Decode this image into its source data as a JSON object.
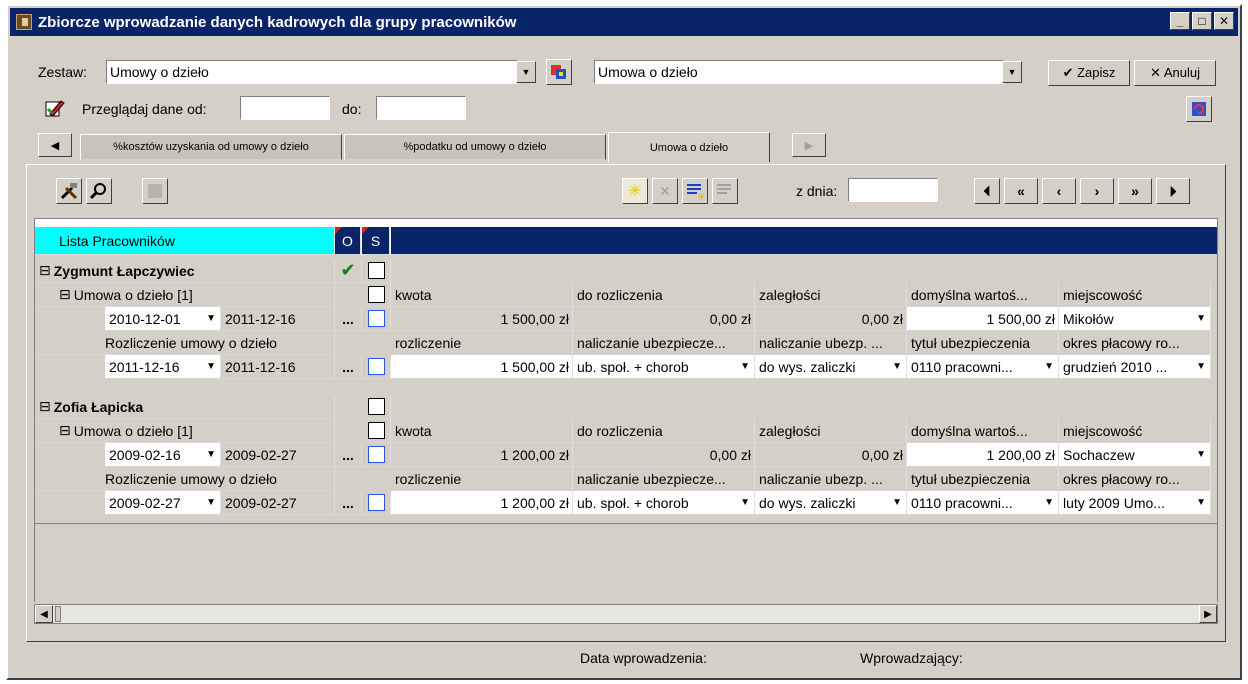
{
  "window": {
    "title": "Zbiorcze wprowadzanie danych kadrowych dla grupy pracowników",
    "min_label": "_",
    "max_label": "□",
    "close_label": "✕"
  },
  "toolbar": {
    "zestaw_label": "Zestaw:",
    "zestaw_value": "Umowy o dzieło",
    "zestaw2_value": "Umowa o dzieło",
    "save_label": "✔ Zapisz",
    "cancel_label": "✕ Anuluj",
    "browse_label": "Przeglądaj dane od:",
    "to_label": "do:",
    "from_date": "",
    "to_date": ""
  },
  "tabs": [
    {
      "label": "%kosztów uzyskania od umowy o dzieło",
      "active": false
    },
    {
      "label": "%podatku od umowy o dzieło",
      "active": false
    },
    {
      "label": "Umowa o dzieło",
      "active": true
    }
  ],
  "panel": {
    "date_label": "z dnia:",
    "date_value": ""
  },
  "grid": {
    "header_list": "Lista Pracowników",
    "header_o": "O",
    "header_s": "S",
    "employees": [
      {
        "name": "Zygmunt Łapczywiec",
        "contract_label": "Umowa o dzieło [1]",
        "contract_cols": [
          "kwota",
          "do rozliczenia",
          "zaległości",
          "domyślna wartoś...",
          "miejscowość"
        ],
        "contract_from": "2010-12-01",
        "contract_to": "2011-12-16",
        "contract_values": [
          "1 500,00 zł",
          "0,00 zł",
          "0,00 zł",
          "1 500,00 zł",
          "Mikołów"
        ],
        "settle_label": "Rozliczenie umowy o dzieło",
        "settle_cols": [
          "rozliczenie",
          "naliczanie ubezpiecze...",
          "naliczanie ubezp. ...",
          "tytuł ubezpieczenia",
          "okres płacowy ro..."
        ],
        "settle_from": "2011-12-16",
        "settle_to": "2011-12-16",
        "settle_values": [
          "1 500,00 zł",
          "ub. społ. + chorob",
          "do wys. zaliczki",
          "0110 pracowni...",
          "grudzień 2010 ..."
        ]
      },
      {
        "name": "Zofia Łapicka",
        "contract_label": "Umowa o dzieło [1]",
        "contract_cols": [
          "kwota",
          "do rozliczenia",
          "zaległości",
          "domyślna wartoś...",
          "miejscowość"
        ],
        "contract_from": "2009-02-16",
        "contract_to": "2009-02-27",
        "contract_values": [
          "1 200,00 zł",
          "0,00 zł",
          "0,00 zł",
          "1 200,00 zł",
          "Sochaczew"
        ],
        "settle_label": "Rozliczenie umowy o dzieło",
        "settle_cols": [
          "rozliczenie",
          "naliczanie ubezpiecze...",
          "naliczanie ubezp. ...",
          "tytuł ubezpieczenia",
          "okres płacowy ro..."
        ],
        "settle_from": "2009-02-27",
        "settle_to": "2009-02-27",
        "settle_values": [
          "1 200,00 zł",
          "ub. społ. + chorob",
          "do wys. zaliczki",
          "0110 pracowni...",
          "luty 2009 Umo..."
        ]
      }
    ],
    "ellipsis": "..."
  },
  "footer": {
    "data_label": "Data wprowadzenia:",
    "author_label": "Wprowadzający:"
  },
  "colors": {
    "title_bg": "#0a246a",
    "header_cyan": "#00ffff",
    "header_navy": "#0a246a"
  }
}
